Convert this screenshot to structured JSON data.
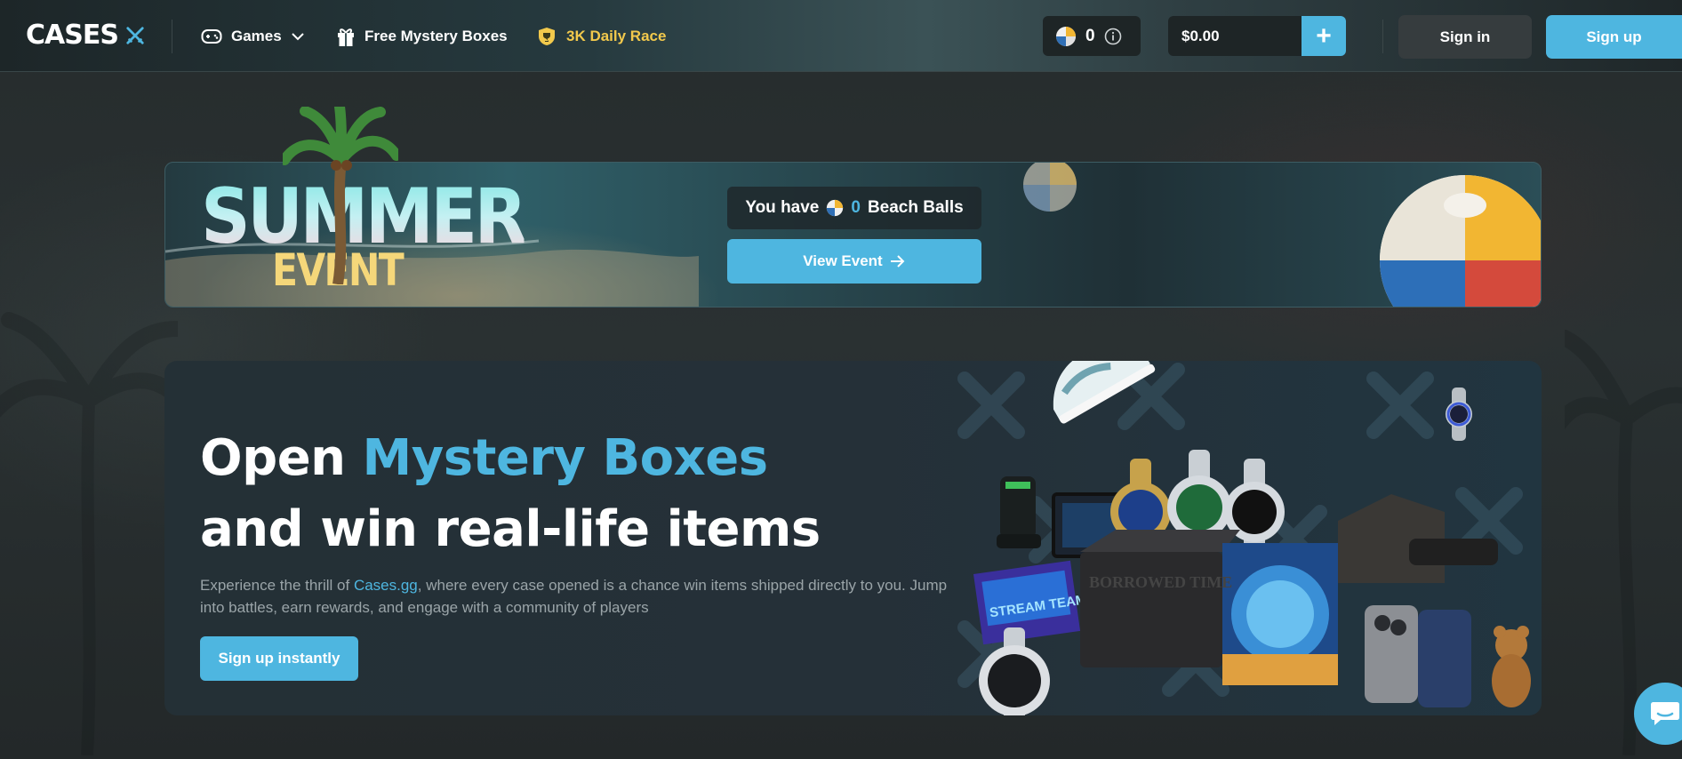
{
  "nav": {
    "logo": "CASES",
    "games_label": "Games",
    "free_boxes_label": "Free Mystery Boxes",
    "race_label": "3K Daily Race",
    "coins_value": "0",
    "balance": "$0.00",
    "plus_label": "+",
    "signin_label": "Sign in",
    "signup_label": "Sign up"
  },
  "banner": {
    "title_top": "SUMMER",
    "title_bottom": "EVENT",
    "you_have_prefix": "You have",
    "beach_balls_count": "0",
    "beach_balls_label": "Beach Balls",
    "view_event_label": "View Event"
  },
  "hero": {
    "title_prefix": "Open",
    "title_accent": "Mystery Boxes",
    "title_line2": "and win real-life items",
    "desc_prefix": "Experience the thrill of",
    "desc_link": "Cases.gg",
    "desc_suffix": ", where every case opened is a chance win items shipped directly to you. Jump into battles, earn rewards, and engage with a community of players",
    "cta_label": "Sign up instantly",
    "box_text_1": "BORROWED TIME",
    "box_text_2": "STREAM TEAM"
  },
  "colors": {
    "accent": "#4eb6e0",
    "race": "#f2c94c",
    "background": "#262c2d"
  },
  "icons": {
    "logo_mark": "crossed-swords-icon",
    "games": "gamepad-icon",
    "free_boxes": "gift-icon",
    "race": "shield-trophy-icon",
    "coin": "beach-ball-icon",
    "info": "info-icon",
    "view_event_arrow": "arrow-right-icon",
    "chat": "chat-icon"
  }
}
